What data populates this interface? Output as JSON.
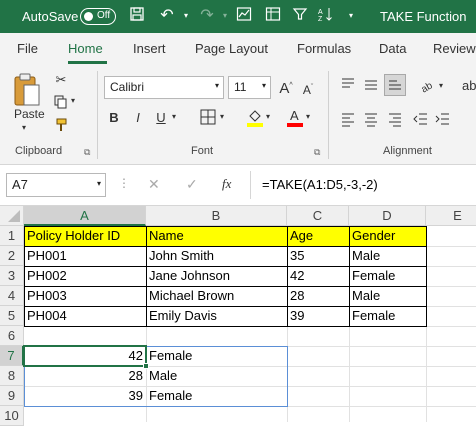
{
  "titlebar": {
    "autosave_label": "AutoSave",
    "toggle_state": "Off",
    "document_title": "TAKE Function",
    "bg_color": "#217346"
  },
  "tabs": [
    {
      "label": "File"
    },
    {
      "label": "Home",
      "active": true
    },
    {
      "label": "Insert"
    },
    {
      "label": "Page Layout"
    },
    {
      "label": "Formulas"
    },
    {
      "label": "Data"
    },
    {
      "label": "Review"
    }
  ],
  "ribbon": {
    "clipboard": {
      "paste_label": "Paste",
      "group_label": "Clipboard"
    },
    "font": {
      "font_name": "Calibri",
      "font_size": "11",
      "group_label": "Font",
      "fill_color": "#ffff00",
      "font_color": "#ff0000"
    },
    "alignment": {
      "group_label": "Alignment"
    }
  },
  "formula_bar": {
    "name_box": "A7",
    "fx_label": "fx",
    "formula": "=TAKE(A1:D5,-3,-2)"
  },
  "grid": {
    "col_headers": [
      "A",
      "B",
      "C",
      "D",
      "E"
    ],
    "row_headers": [
      "1",
      "2",
      "3",
      "4",
      "5",
      "6",
      "7",
      "8",
      "9",
      "10"
    ],
    "header_row": [
      "Policy Holder ID",
      "Name",
      "Age",
      "Gender"
    ],
    "rows": [
      [
        "PH001",
        "John Smith",
        "35",
        "Male"
      ],
      [
        "PH002",
        "Jane Johnson",
        "42",
        "Female"
      ],
      [
        "PH003",
        "Michael Brown",
        "28",
        "Male"
      ],
      [
        "PH004",
        "Emily Davis",
        "39",
        "Female"
      ]
    ],
    "result": [
      [
        "42",
        "Female"
      ],
      [
        "28",
        "Male"
      ],
      [
        "39",
        "Female"
      ]
    ],
    "highlight_color": "#ffff00",
    "selection_color": "#217346"
  }
}
